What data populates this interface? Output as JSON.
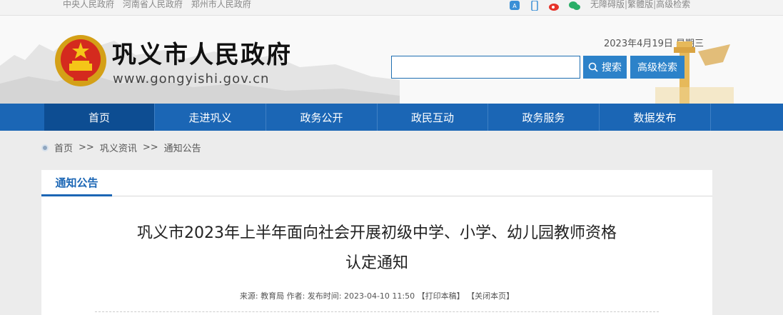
{
  "topbar": {
    "links": [
      "中央人民政府",
      "河南省人民政府",
      "郑州市人民政府"
    ],
    "right_links": [
      "无障碍版",
      "繁體版",
      "高级检索"
    ],
    "separator": "|"
  },
  "header": {
    "site_name": "巩义市人民政府",
    "domain": "www.gongyishi.gov.cn",
    "date": "2023年4月19日 星期三",
    "search_placeholder": "",
    "search_label": "搜索",
    "advanced_label": "高级检索"
  },
  "nav": {
    "items": [
      "首页",
      "走进巩义",
      "政务公开",
      "政民互动",
      "政务服务",
      "数据发布"
    ]
  },
  "breadcrumb": {
    "home": "首页",
    "sep": ">>",
    "level1": "巩义资讯",
    "level2": "通知公告"
  },
  "article": {
    "section": "通知公告",
    "title_line1": "巩义市2023年上半年面向社会开展初级中学、小学、幼儿园教师资格",
    "title_line2": "认定通知",
    "meta": "来源: 教育局 作者: 发布时间:  2023-04-10 11:50 【打印本稿】 【关闭本页】"
  },
  "colors": {
    "nav": "#1b66b5",
    "nav_active": "#0d4d92",
    "button": "#2c82c9"
  }
}
